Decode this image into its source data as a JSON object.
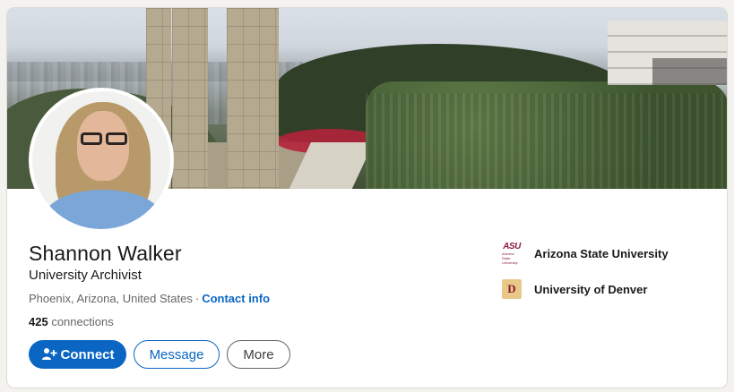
{
  "profile": {
    "name": "Shannon Walker",
    "headline": "University Archivist",
    "location": "Phoenix, Arizona, United States",
    "separator": "·",
    "contact_info_label": "Contact info",
    "connections_count": "425",
    "connections_label": "connections"
  },
  "actions": {
    "connect_label": "Connect",
    "message_label": "Message",
    "more_label": "More"
  },
  "education": [
    {
      "name": "Arizona State University",
      "logo": "ASU",
      "logo_sub": "Arizona State University"
    },
    {
      "name": "University of Denver",
      "logo": "D"
    }
  ],
  "colors": {
    "accent": "#0a66c2",
    "text": "#191919",
    "muted": "#666666",
    "asu": "#8c1d40"
  }
}
